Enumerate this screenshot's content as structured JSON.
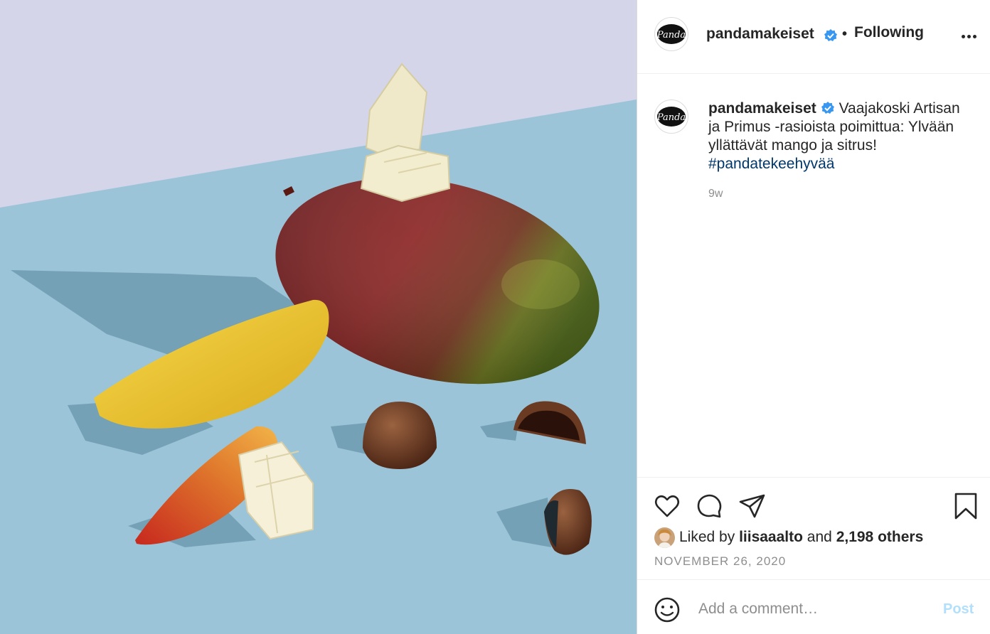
{
  "post": {
    "author": "pandamakeiset",
    "follow_status": "Following",
    "separator": "•",
    "caption": {
      "username": "pandamakeiset",
      "text": "Vaajakoski Artisan ja Primus -rasioista poimittua: Ylvään yllättävät mango ja sitrus!",
      "hashtag": "#pandatekeehyvää",
      "time_ago": "9w"
    },
    "likes": {
      "prefix": "Liked by",
      "liked_by": "liisaaalto",
      "joiner": "and",
      "others": "2,198 others"
    },
    "date": "NOVEMBER 26, 2020"
  },
  "comment": {
    "placeholder": "Add a comment…",
    "post_label": "Post"
  },
  "icons": {
    "verified": "verified-badge-icon",
    "more": "more-options-icon",
    "like": "heart-icon",
    "comment": "comment-icon",
    "share": "paper-plane-icon",
    "save": "bookmark-icon",
    "emoji": "emoji-icon"
  },
  "colors": {
    "verified_blue": "#3897f0",
    "hashtag": "#00376b",
    "muted": "#8e8e8e",
    "post_disabled": "#b2dffc"
  }
}
